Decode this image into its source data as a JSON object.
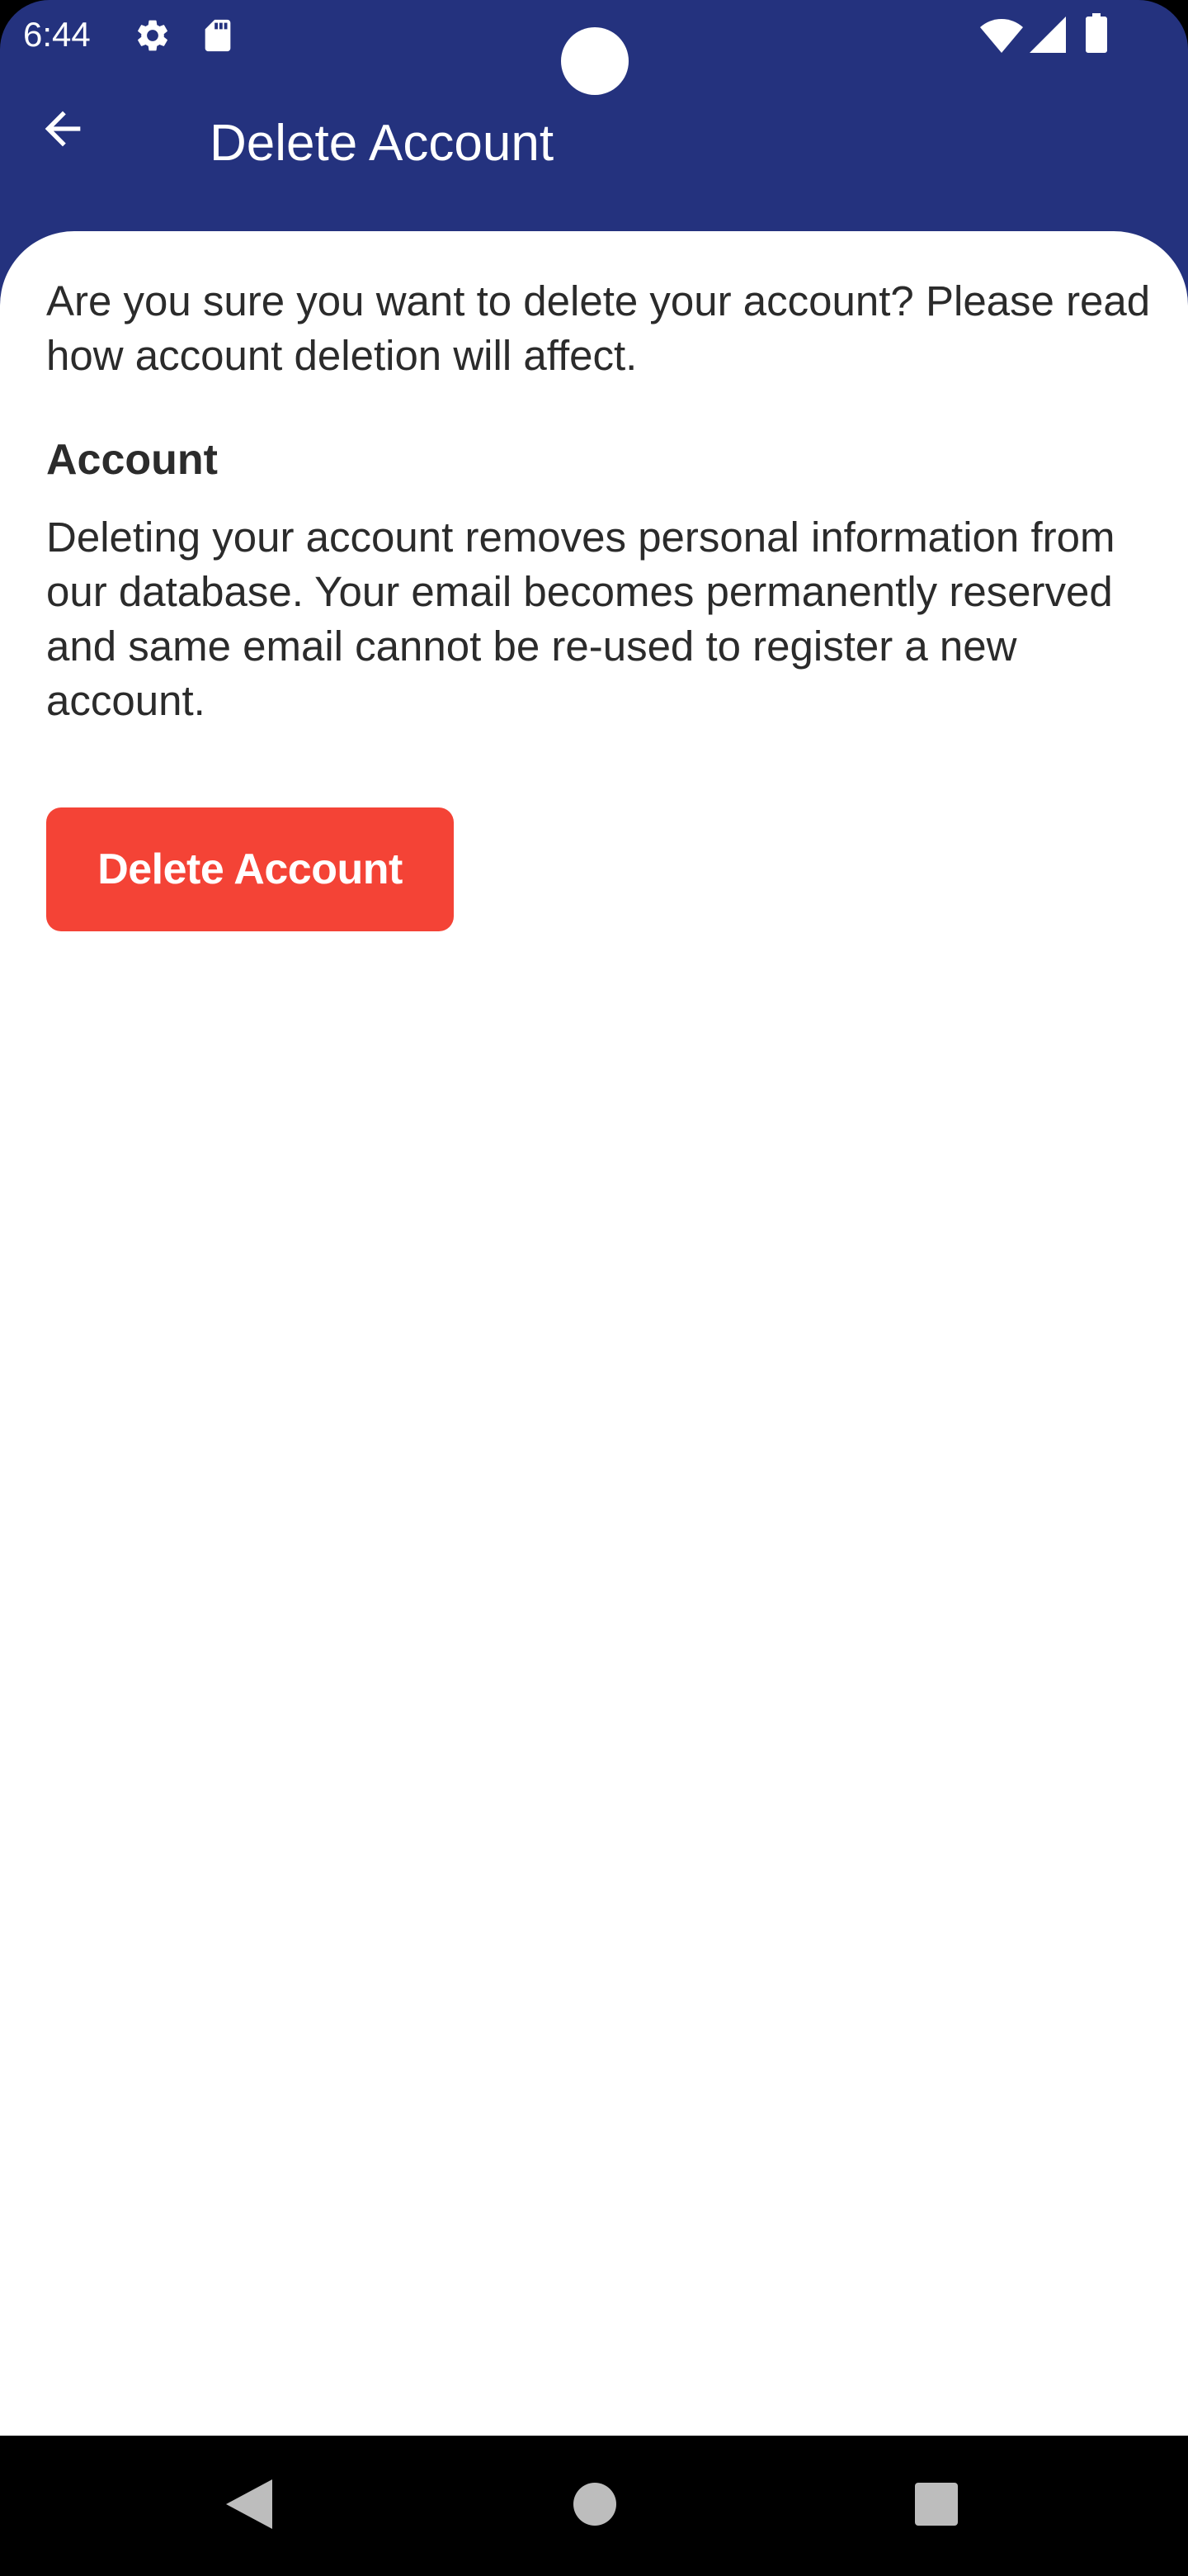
{
  "status_bar": {
    "time": "6:44",
    "icons": [
      "gear-icon",
      "sd-card-icon",
      "wifi-icon",
      "signal-icon",
      "battery-icon"
    ]
  },
  "app_bar": {
    "title": "Delete Account",
    "back_icon": "arrow-back-icon",
    "background_color": "#24327e"
  },
  "content": {
    "intro": "Are you sure you want to delete your account? Please read how account deletion will affect.",
    "section_heading": "Account",
    "section_body": "Deleting your account removes personal information from our database. Your email becomes permanently reserved and same email cannot be re-used to register a new account.",
    "delete_button_label": "Delete Account",
    "delete_button_color": "#f44336"
  },
  "nav_bar": {
    "buttons": [
      "back-triangle-icon",
      "home-circle-icon",
      "recents-square-icon"
    ]
  }
}
